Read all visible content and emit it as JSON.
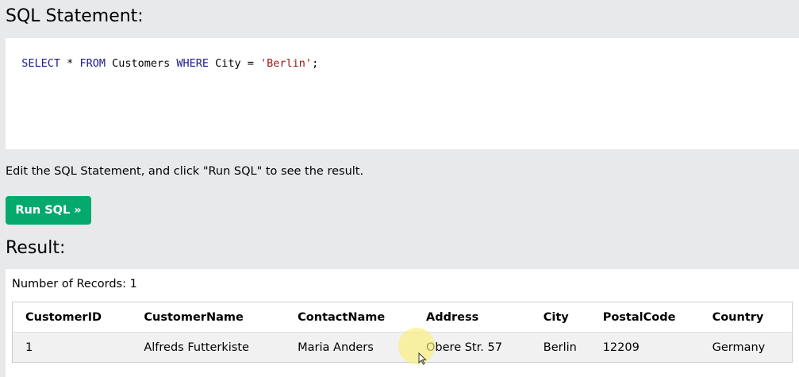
{
  "sql_section": {
    "heading": "SQL Statement:",
    "query_parts": [
      {
        "text": "SELECT",
        "kind": "kw"
      },
      {
        "text": " * ",
        "kind": "plain"
      },
      {
        "text": "FROM",
        "kind": "kw"
      },
      {
        "text": " Customers ",
        "kind": "plain"
      },
      {
        "text": "WHERE",
        "kind": "kw"
      },
      {
        "text": " City = ",
        "kind": "plain"
      },
      {
        "text": "'Berlin'",
        "kind": "str"
      },
      {
        "text": ";",
        "kind": "plain"
      }
    ]
  },
  "instructions": "Edit the SQL Statement, and click \"Run SQL\" to see the result.",
  "run_button": {
    "label": "Run SQL »",
    "color": "#04aa6d"
  },
  "result_section": {
    "heading": "Result:",
    "record_count": "Number of Records: 1",
    "columns": [
      "CustomerID",
      "CustomerName",
      "ContactName",
      "Address",
      "City",
      "PostalCode",
      "Country"
    ],
    "rows": [
      [
        "1",
        "Alfreds Futterkiste",
        "Maria Anders",
        "Obere Str. 57",
        "Berlin",
        "12209",
        "Germany"
      ]
    ]
  }
}
